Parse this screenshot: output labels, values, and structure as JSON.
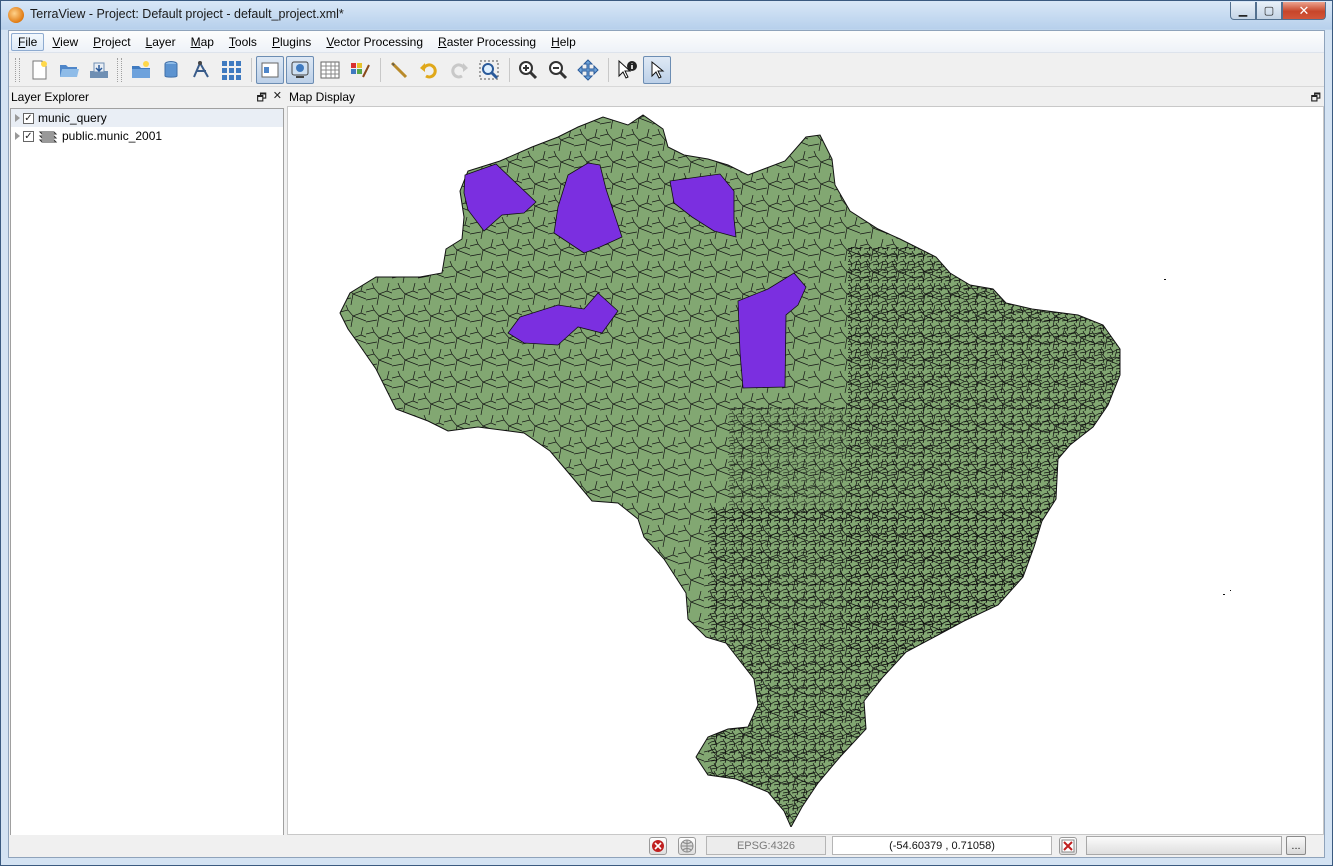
{
  "window": {
    "title": "TerraView - Project: Default project - default_project.xml*",
    "controls": {
      "minimize": "▁",
      "maximize": "▢",
      "close": "✕"
    }
  },
  "menu": [
    {
      "label": "File",
      "mnemonic": "F",
      "rest": "ile"
    },
    {
      "label": "View",
      "mnemonic": "V",
      "rest": "iew"
    },
    {
      "label": "Project",
      "mnemonic": "P",
      "rest": "roject"
    },
    {
      "label": "Layer",
      "mnemonic": "L",
      "rest": "ayer"
    },
    {
      "label": "Map",
      "mnemonic": "M",
      "rest": "ap"
    },
    {
      "label": "Tools",
      "mnemonic": "T",
      "rest": "ools"
    },
    {
      "label": "Plugins",
      "mnemonic": "P",
      "rest": "lugins"
    },
    {
      "label": "Vector Processing",
      "mnemonic": "V",
      "rest": "ector Processing"
    },
    {
      "label": "Raster Processing",
      "mnemonic": "R",
      "rest": "aster Processing"
    },
    {
      "label": "Help",
      "mnemonic": "H",
      "rest": "elp"
    }
  ],
  "toolbar_icons": [
    "new-project-icon",
    "open-project-icon",
    "save-project-icon",
    "add-layer-icon",
    "add-datasource-icon",
    "vector-tool-icon",
    "grid-icon",
    "layer-explorer-toggle-icon",
    "map-display-toggle-icon",
    "table-view-icon",
    "style-explorer-icon",
    "measure-distance-icon",
    "undo-icon",
    "redo-icon",
    "zoom-extent-icon",
    "zoom-in-icon",
    "zoom-out-icon",
    "pan-icon",
    "info-icon",
    "selection-icon"
  ],
  "layer_explorer": {
    "title": "Layer Explorer",
    "float_label": "🗗",
    "close_label": "✕",
    "layers": [
      {
        "name": "munic_query",
        "checked": true,
        "selected": true
      },
      {
        "name": "public.munic_2001",
        "checked": true,
        "selected": false
      }
    ]
  },
  "map_display": {
    "title": "Map Display",
    "float_label": "🗗",
    "fill_color": "#82a772",
    "highlight_color": "#7b2fe0",
    "outline_color": "#111111"
  },
  "status": {
    "srs": "EPSG:4326",
    "coordinates": "(-54.60379 , 0.71058)",
    "more_button": "..."
  }
}
